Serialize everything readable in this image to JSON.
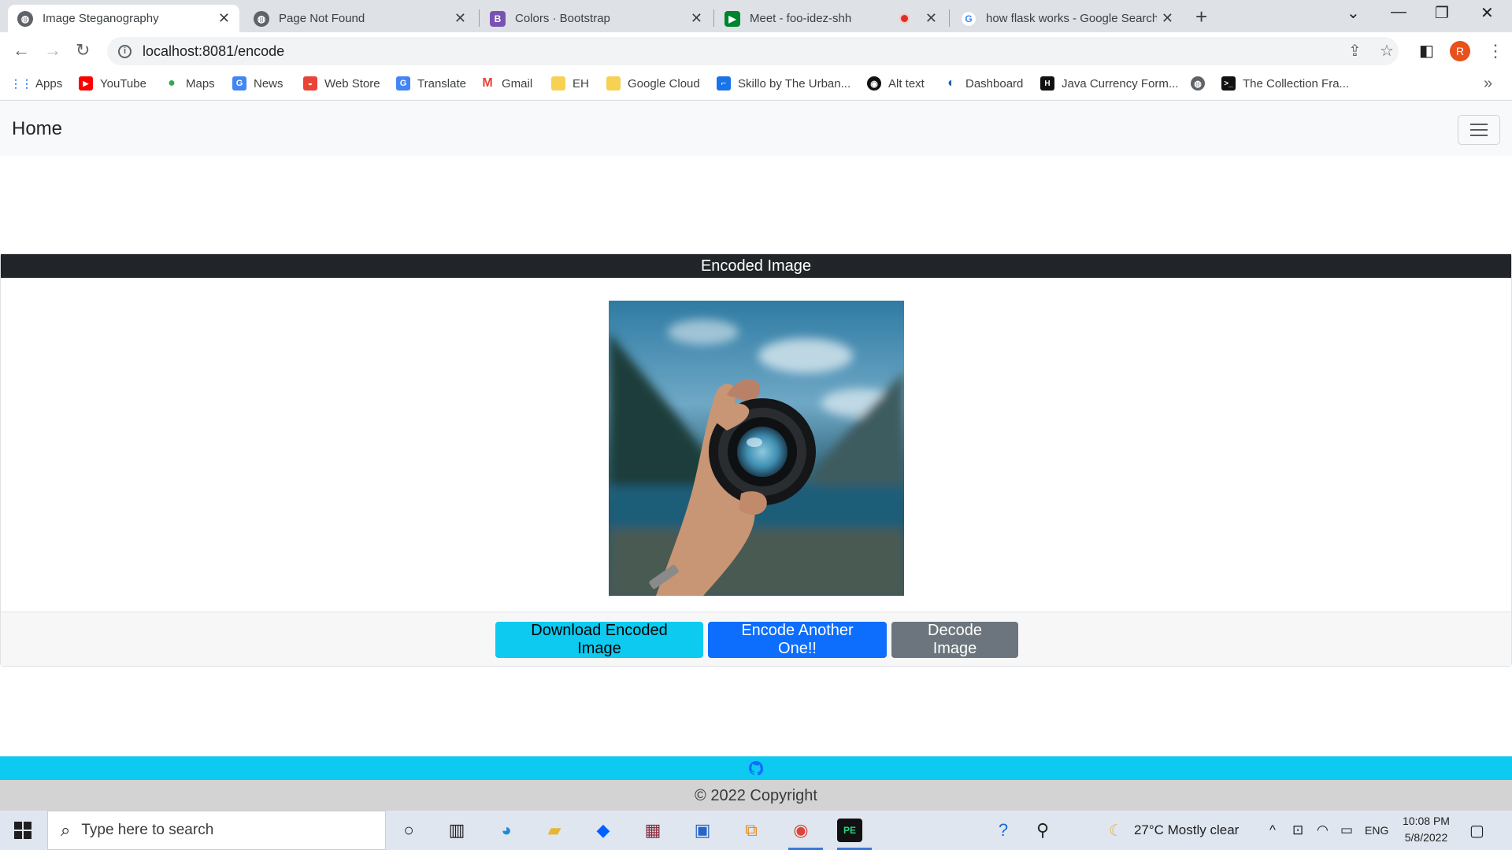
{
  "browser": {
    "tabs": [
      {
        "title": "Image Steganography",
        "active": true,
        "icon": "globe-icon"
      },
      {
        "title": "Page Not Found",
        "active": false,
        "icon": "globe-icon"
      },
      {
        "title": "Colors · Bootstrap",
        "active": false,
        "icon": "bootstrap-icon"
      },
      {
        "title": "Meet - foo-idez-shh",
        "active": false,
        "icon": "google-meet-icon"
      },
      {
        "title": "how flask works - Google Search",
        "active": false,
        "icon": "google-icon"
      }
    ],
    "url": "localhost:8081/encode",
    "profile_initial": "R",
    "bookmarks": [
      {
        "label": "Apps",
        "icon": "apps-grid-icon"
      },
      {
        "label": "YouTube",
        "icon": "youtube-icon"
      },
      {
        "label": "Maps",
        "icon": "maps-icon"
      },
      {
        "label": "News",
        "icon": "news-icon"
      },
      {
        "label": "Web Store",
        "icon": "web-store-icon"
      },
      {
        "label": "Translate",
        "icon": "translate-icon"
      },
      {
        "label": "Gmail",
        "icon": "gmail-icon"
      },
      {
        "label": "EH",
        "icon": "folder-icon"
      },
      {
        "label": "Google Cloud",
        "icon": "folder-icon"
      },
      {
        "label": "Skillo by The Urban...",
        "icon": "skillo-icon"
      },
      {
        "label": "Alt text",
        "icon": "github-icon"
      },
      {
        "label": "Dashboard",
        "icon": "dashboard-icon"
      },
      {
        "label": "Java Currency Form...",
        "icon": "hackerrank-icon"
      },
      {
        "label": "",
        "icon": "globe-icon"
      },
      {
        "label": "The Collection Fra...",
        "icon": "terminal-icon"
      }
    ]
  },
  "page": {
    "brand": "Home",
    "card_title": "Encoded Image",
    "buttons": {
      "download": "Download Encoded Image",
      "encode_another": "Encode Another One!!",
      "decode": "Decode Image"
    },
    "copyright": "© 2022 Copyright"
  },
  "taskbar": {
    "search_placeholder": "Type here to search",
    "weather": "27°C  Mostly clear",
    "language": "ENG",
    "time": "10:08 PM",
    "date": "5/8/2022"
  },
  "colors": {
    "info": "#0dcaf0",
    "primary": "#0d6efd",
    "secondary": "#6c757d",
    "dark": "#212529"
  }
}
